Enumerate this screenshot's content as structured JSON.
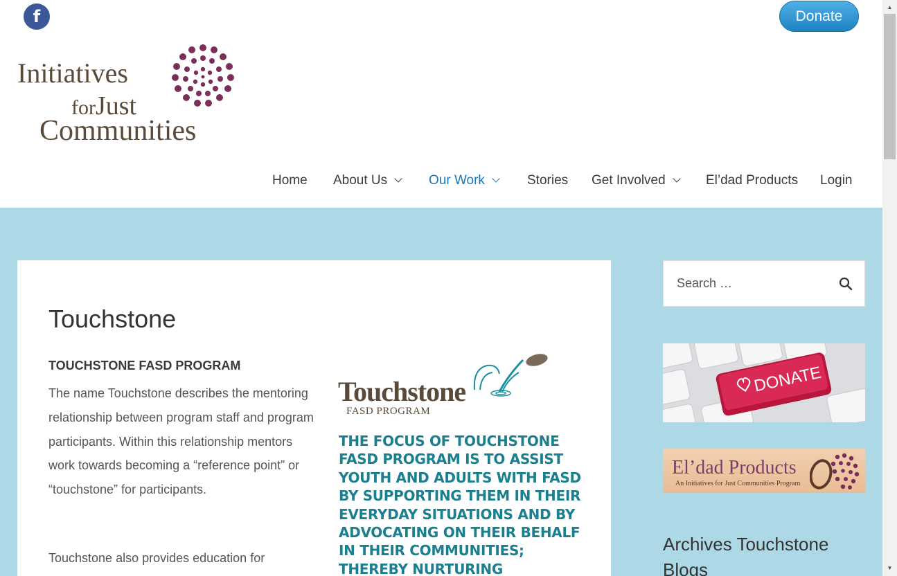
{
  "header": {
    "facebook_icon": "facebook-icon",
    "donate_label": "Donate",
    "logo": {
      "line1": "Initiatives",
      "line2_small": "for",
      "line2": "Just",
      "line3": "Communities"
    }
  },
  "nav": {
    "items": [
      {
        "label": "Home",
        "has_dropdown": false
      },
      {
        "label": "About Us",
        "has_dropdown": true
      },
      {
        "label": "Our Work",
        "has_dropdown": true,
        "active": true
      },
      {
        "label": "Stories",
        "has_dropdown": false
      },
      {
        "label": "Get Involved",
        "has_dropdown": true
      },
      {
        "label": "El’dad Products",
        "has_dropdown": false
      },
      {
        "label": "Login",
        "has_dropdown": false
      }
    ],
    "active_color": "#1a78b8"
  },
  "article": {
    "title": "Touchstone",
    "program_heading": "TOUCHSTONE FASD PROGRAM",
    "paragraph1": "The name Touchstone describes the mentoring relationship between program staff and program participants. Within this relationship mentors work towards becoming a “reference point” or “touchstone” for participants.",
    "paragraph2": "Touchstone also provides education for",
    "touchstone_logo": {
      "word": "Touchstone",
      "sub": "FASD PROGRAM"
    },
    "focus_text": "THE FOCUS OF TOUCHSTONE FASD PROGRAM IS TO ASSIST YOUTH AND ADULTS WITH FASD BY SUPPORTING THEM IN THEIR EVERYDAY SITUATIONS AND BY ADVOCATING ON THEIR BEHALF IN THEIR COMMUNITIES; THEREBY NURTURING OPPORTUNITIES FOR"
  },
  "sidebar": {
    "search_placeholder": "Search …",
    "donate_key_label": "DONATE",
    "eldad": {
      "title": "El’dad Products",
      "subtitle": "An Initiatives for Just Communities Program"
    },
    "archives_heading": "Archives Touchstone Blogs"
  },
  "colors": {
    "background": "#add8e6",
    "brand_purple": "#7a2f5a",
    "teal": "#1a7f8e",
    "donate_blue": "#2c8fcd"
  }
}
